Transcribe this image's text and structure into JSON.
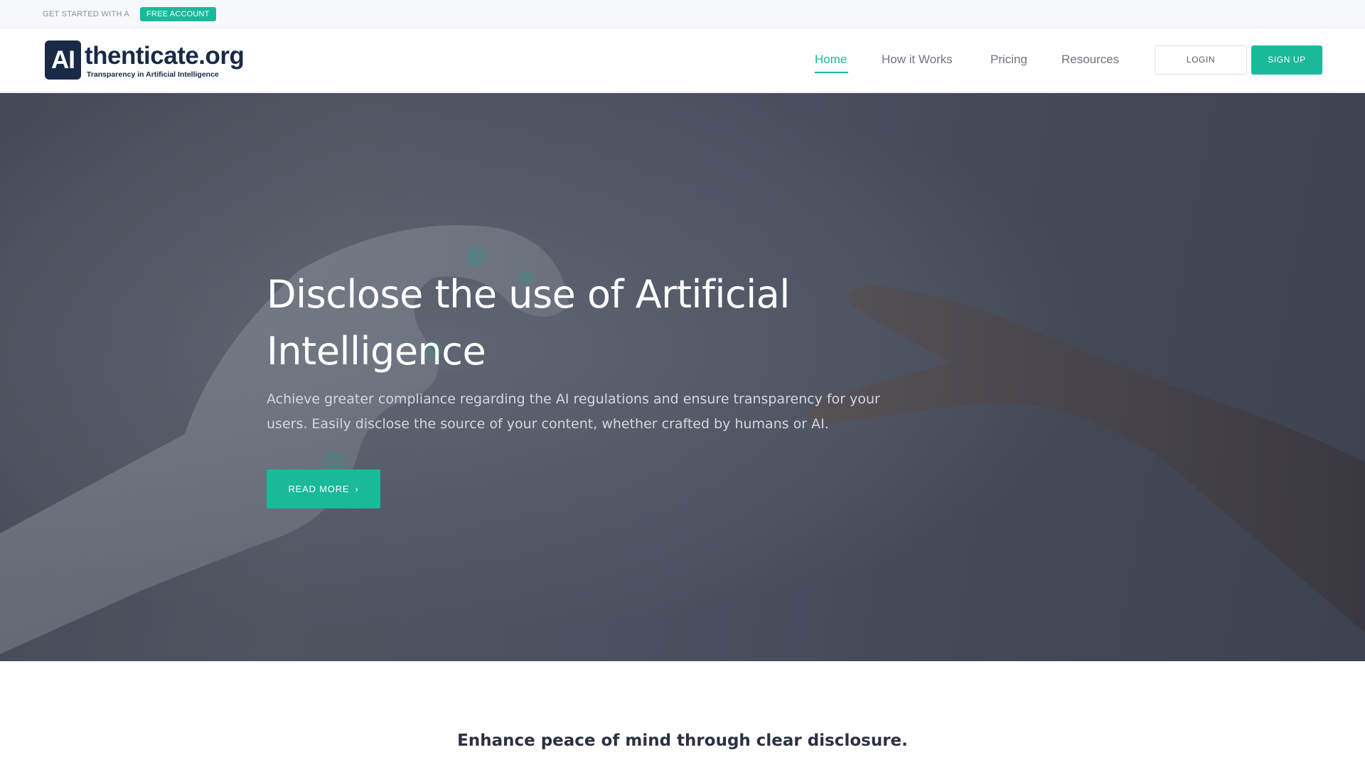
{
  "promo": {
    "text": "GET STARTED WITH A",
    "badge": "FREE ACCOUNT"
  },
  "header": {
    "logo": {
      "box_text": "AI",
      "word": "thenticate.org",
      "tagline": "Transparency in Artificial Intelligence"
    },
    "nav": [
      {
        "label": "Home",
        "active": true
      },
      {
        "label": "How it Works",
        "active": false
      },
      {
        "label": "Pricing",
        "active": false
      },
      {
        "label": "Resources",
        "active": false
      }
    ],
    "login_label": "LOGIN",
    "signup_label": "SIGN UP"
  },
  "hero": {
    "title": "Disclose the use of Artificial Intelligence",
    "subtitle": "Achieve greater compliance regarding the AI regulations and ensure transparency for your users. Easily disclose the source of your content, whether crafted by humans or AI.",
    "cta_label": "READ MORE",
    "cta_icon": "chevron-right-icon"
  },
  "section": {
    "tagline": "Enhance peace of mind through clear disclosure."
  },
  "colors": {
    "accent": "#19b99a",
    "brand_navy": "#1a2a46",
    "hero_overlay": "#3a3e4e"
  }
}
